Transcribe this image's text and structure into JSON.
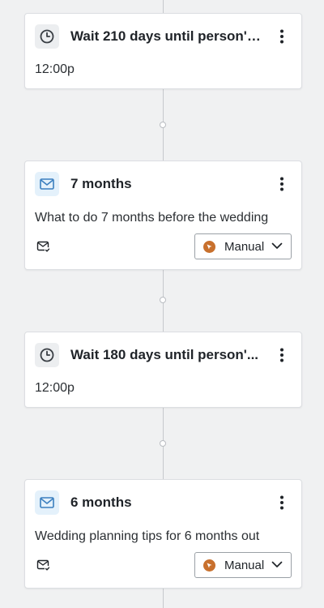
{
  "flow": {
    "steps": [
      {
        "type": "wait",
        "icon": "clock-icon",
        "title": "Wait 210 days until person's...",
        "time": "12:00p"
      },
      {
        "type": "email",
        "icon": "envelope-icon",
        "title": "7 months",
        "subject": "What to do 7 months before the wedding",
        "footer_icon": "email-check-icon",
        "mode": "Manual"
      },
      {
        "type": "wait",
        "icon": "clock-icon",
        "title": "Wait 180 days until person'...",
        "time": "12:00p"
      },
      {
        "type": "email",
        "icon": "envelope-icon",
        "title": "6 months",
        "subject": "Wedding planning tips for 6 months out",
        "footer_icon": "email-check-icon",
        "mode": "Manual"
      }
    ]
  },
  "colors": {
    "background": "#f0f1f2",
    "email_icon": "#3b7fbf",
    "manual_badge": "#c8702d"
  }
}
